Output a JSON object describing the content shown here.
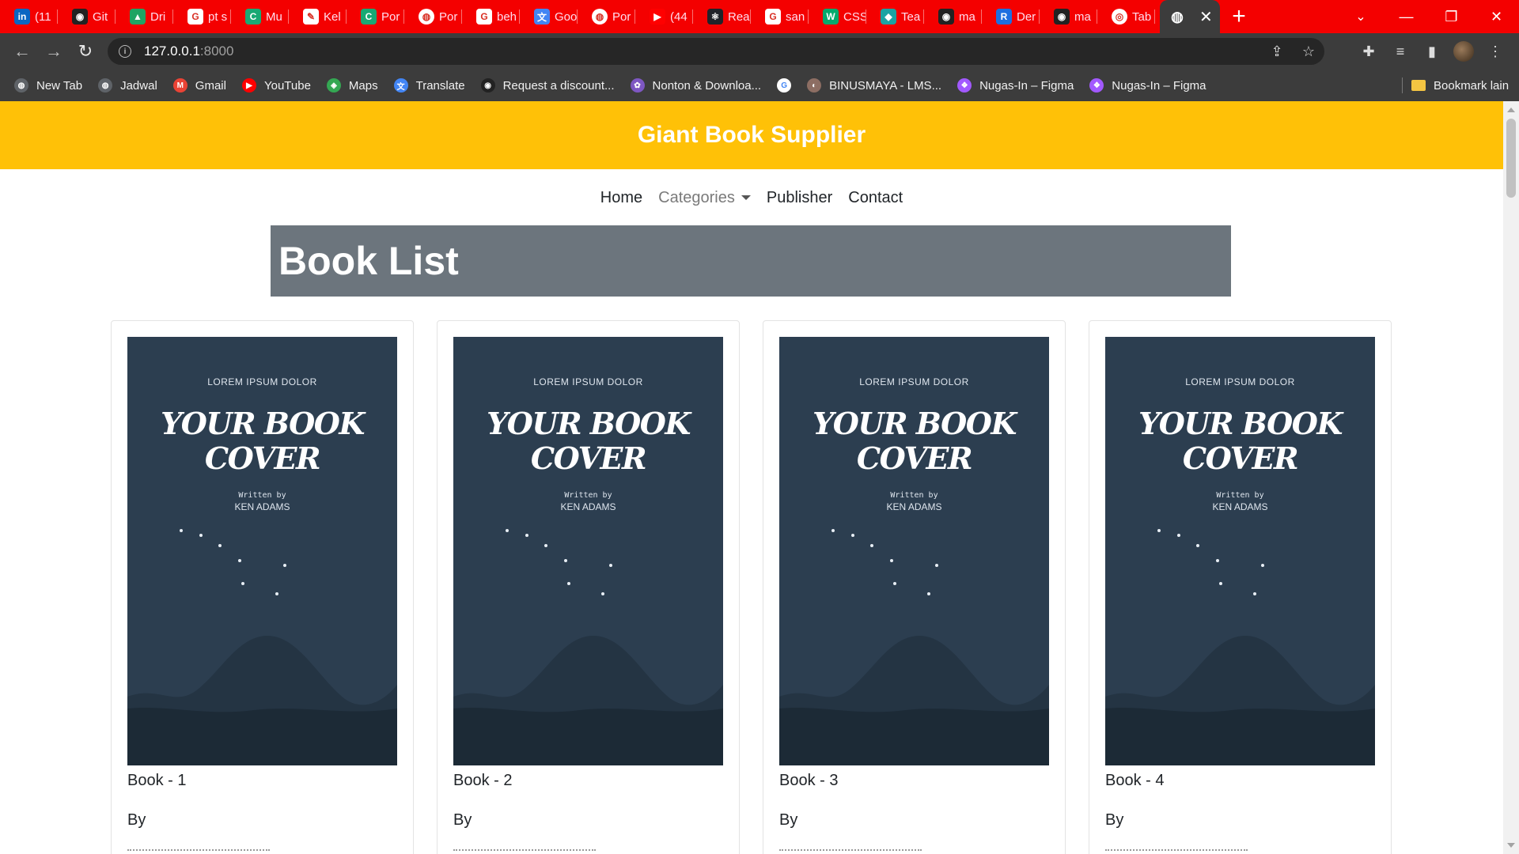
{
  "browser": {
    "tabs": [
      {
        "title": "(11",
        "favicon": "linkedin-icon",
        "color": "#0a66c2",
        "glyph": "in"
      },
      {
        "title": "Git",
        "favicon": "github-icon",
        "color": "#222222",
        "glyph": "◉"
      },
      {
        "title": "Dri",
        "favicon": "drive-icon",
        "color": "#1fa463",
        "glyph": "▲"
      },
      {
        "title": "pt s",
        "favicon": "google-icon",
        "color": "#ffffff",
        "glyph": "G"
      },
      {
        "title": "Mu",
        "favicon": "c-icon",
        "color": "#19a974",
        "glyph": "C"
      },
      {
        "title": "Kel",
        "favicon": "document-icon",
        "color": "#ffffff",
        "glyph": "✎"
      },
      {
        "title": "Por",
        "favicon": "c-icon",
        "color": "#19a974",
        "glyph": "C"
      },
      {
        "title": "Por",
        "favicon": "globe-icon",
        "color": "#ffffff",
        "glyph": "◍"
      },
      {
        "title": "beh",
        "favicon": "google-icon",
        "color": "#ffffff",
        "glyph": "G"
      },
      {
        "title": "Goo",
        "favicon": "translate-icon",
        "color": "#4285f4",
        "glyph": "文"
      },
      {
        "title": "Por",
        "favicon": "globe-icon",
        "color": "#ffffff",
        "glyph": "◍"
      },
      {
        "title": "(44",
        "favicon": "youtube-icon",
        "color": "#ff0000",
        "glyph": "▶"
      },
      {
        "title": "Rea",
        "favicon": "react-icon",
        "color": "#20232a",
        "glyph": "⚛"
      },
      {
        "title": "san",
        "favicon": "google-icon",
        "color": "#ffffff",
        "glyph": "G"
      },
      {
        "title": "CSS",
        "favicon": "w3schools-icon",
        "color": "#04aa6d",
        "glyph": "W"
      },
      {
        "title": "Tea",
        "favicon": "diamond-icon",
        "color": "#1aa3a3",
        "glyph": "◆"
      },
      {
        "title": "ma",
        "favicon": "github-icon",
        "color": "#222222",
        "glyph": "◉"
      },
      {
        "title": "Der",
        "favicon": "r-icon",
        "color": "#1d6fe0",
        "glyph": "R"
      },
      {
        "title": "ma",
        "favicon": "github-icon",
        "color": "#222222",
        "glyph": "◉"
      },
      {
        "title": "Tab",
        "favicon": "chrome-icon",
        "color": "#ffffff",
        "glyph": "◎"
      }
    ],
    "active_tab": {
      "favicon": "globe-icon",
      "close": "✕"
    },
    "new_tab": "+",
    "url_host": "127.0.0.1",
    "url_port": ":8000",
    "bookmarks": [
      {
        "label": "New Tab",
        "icon": "globe-icon",
        "color": "#5f6368",
        "glyph": "◍"
      },
      {
        "label": "Jadwal",
        "icon": "globe-icon",
        "color": "#5f6368",
        "glyph": "◍"
      },
      {
        "label": "Gmail",
        "icon": "gmail-icon",
        "color": "#ea4335",
        "glyph": "M"
      },
      {
        "label": "YouTube",
        "icon": "youtube-icon",
        "color": "#ff0000",
        "glyph": "▶"
      },
      {
        "label": "Maps",
        "icon": "maps-icon",
        "color": "#34a853",
        "glyph": "◈"
      },
      {
        "label": "Translate",
        "icon": "translate-icon",
        "color": "#4285f4",
        "glyph": "文"
      },
      {
        "label": "Request a discount...",
        "icon": "github-icon",
        "color": "#222222",
        "glyph": "◉"
      },
      {
        "label": "Nonton & Downloa...",
        "icon": "pinwheel-icon",
        "color": "#7e57c2",
        "glyph": "✿"
      },
      {
        "label": "",
        "icon": "google-icon",
        "color": "#ffffff",
        "glyph": "G"
      },
      {
        "label": "BINUSMAYA - LMS...",
        "icon": "binus-icon",
        "color": "#8d6e63",
        "glyph": "◐"
      },
      {
        "label": "Nugas-In – Figma",
        "icon": "figma-icon",
        "color": "#a259ff",
        "glyph": "❖"
      },
      {
        "label": "Nugas-In – Figma",
        "icon": "figma-icon",
        "color": "#a259ff",
        "glyph": "❖"
      }
    ],
    "other_bookmarks": "Bookmark lain"
  },
  "site": {
    "title": "Giant Book Supplier",
    "nav": {
      "home": "Home",
      "categories": "Categories",
      "publisher": "Publisher",
      "contact": "Contact"
    },
    "page_heading": "Book List",
    "cover": {
      "tagline": "LOREM IPSUM DOLOR",
      "title_line1": "YOUR BOOK",
      "title_line2": "COVER",
      "written_by": "Written by",
      "author": "KEN ADAMS"
    },
    "books": [
      {
        "name": "Book - 1",
        "by": "By"
      },
      {
        "name": "Book - 2",
        "by": "By"
      },
      {
        "name": "Book - 3",
        "by": "By"
      },
      {
        "name": "Book - 4",
        "by": "By"
      }
    ]
  },
  "colors": {
    "tabstrip": "#f40000",
    "chrome": "#3c3c3c",
    "header": "#ffc107",
    "banner": "#6c757d",
    "cover": "#2c3e50",
    "mountain": "#1c2a36"
  }
}
